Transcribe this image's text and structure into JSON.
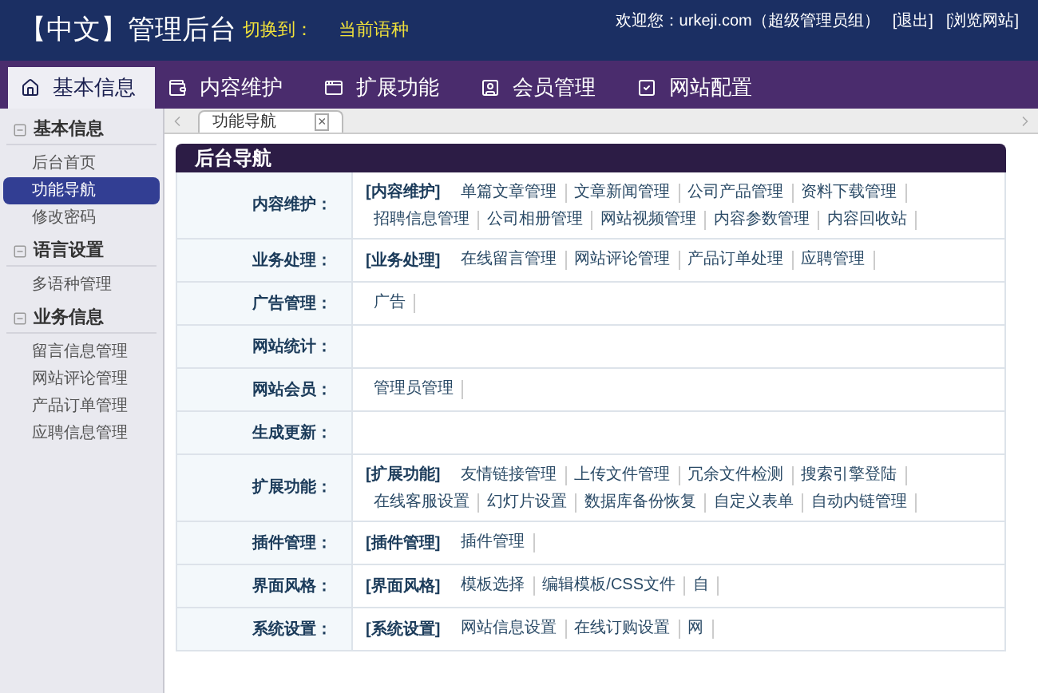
{
  "header": {
    "title": "【中文】管理后台",
    "switch_label": "切换到：",
    "current_language": "当前语种",
    "links": [
      "欢迎您：urkeji.com（超级管理员组）",
      "[退出]",
      "[浏览网站]"
    ]
  },
  "main_tabs": [
    {
      "label": "基本信息",
      "selected": true
    },
    {
      "label": "内容维护",
      "selected": false
    },
    {
      "label": "扩展功能",
      "selected": false
    },
    {
      "label": "会员管理",
      "selected": false
    },
    {
      "label": "网站配置",
      "selected": false
    }
  ],
  "sidebar": {
    "groups": [
      {
        "title": "基本信息",
        "items": [
          {
            "label": "后台首页",
            "selected": false
          },
          {
            "label": "功能导航",
            "selected": true
          },
          {
            "label": "修改密码",
            "selected": false
          }
        ]
      },
      {
        "title": "语言设置",
        "items": [
          {
            "label": "多语种管理",
            "selected": false
          }
        ]
      },
      {
        "title": "业务信息",
        "items": [
          {
            "label": "留言信息管理",
            "selected": false
          },
          {
            "label": "网站评论管理",
            "selected": false
          },
          {
            "label": "产品订单管理",
            "selected": false
          },
          {
            "label": "应聘信息管理",
            "selected": false
          }
        ]
      }
    ]
  },
  "page_tabs": [
    {
      "label": "功能导航",
      "close": "×",
      "selected": true
    }
  ],
  "panel": {
    "title": "后台导航",
    "rows": [
      {
        "label": "内容维护：",
        "links": [
          {
            "kind": "section",
            "text": "[内容维护]"
          },
          {
            "kind": "link",
            "text": "单篇文章管理"
          },
          {
            "kind": "link",
            "text": "文章新闻管理"
          },
          {
            "kind": "link",
            "text": "公司产品管理"
          },
          {
            "kind": "link",
            "text": "资料下载管理"
          },
          {
            "kind": "link",
            "text": "招聘信息管理"
          },
          {
            "kind": "link",
            "text": "公司相册管理"
          },
          {
            "kind": "link",
            "text": "网站视频管理"
          },
          {
            "kind": "link",
            "text": "内容参数管理"
          },
          {
            "kind": "link",
            "text": "内容回收站"
          }
        ]
      },
      {
        "label": "业务处理：",
        "links": [
          {
            "kind": "section",
            "text": "[业务处理]"
          },
          {
            "kind": "link",
            "text": "在线留言管理"
          },
          {
            "kind": "link",
            "text": "网站评论管理"
          },
          {
            "kind": "link",
            "text": "产品订单处理"
          },
          {
            "kind": "link",
            "text": "应聘管理"
          }
        ]
      },
      {
        "label": "广告管理：",
        "links": [
          {
            "kind": "link",
            "text": "广告"
          }
        ]
      },
      {
        "label": "网站统计：",
        "links": []
      },
      {
        "label": "网站会员：",
        "links": [
          {
            "kind": "link",
            "text": "管理员管理"
          }
        ]
      },
      {
        "label": "生成更新：",
        "links": []
      },
      {
        "label": "扩展功能：",
        "links": [
          {
            "kind": "section",
            "text": "[扩展功能]"
          },
          {
            "kind": "link",
            "text": "友情链接管理"
          },
          {
            "kind": "link",
            "text": "上传文件管理"
          },
          {
            "kind": "link",
            "text": "冗余文件检测"
          },
          {
            "kind": "link",
            "text": "搜索引擎登陆"
          },
          {
            "kind": "link",
            "text": "在线客服设置"
          },
          {
            "kind": "link",
            "text": "幻灯片设置"
          },
          {
            "kind": "link",
            "text": "数据库备份恢复"
          },
          {
            "kind": "link",
            "text": "自定义表单"
          },
          {
            "kind": "link",
            "text": "自动内链管理"
          }
        ]
      },
      {
        "label": "插件管理：",
        "links": [
          {
            "kind": "section",
            "text": "[插件管理]"
          },
          {
            "kind": "link",
            "text": "插件管理"
          }
        ]
      },
      {
        "label": "界面风格：",
        "links": [
          {
            "kind": "section",
            "text": "[界面风格]"
          },
          {
            "kind": "link",
            "text": "模板选择"
          },
          {
            "kind": "link",
            "text": "编辑模板/CSS文件"
          },
          {
            "kind": "link",
            "text": "自"
          }
        ]
      },
      {
        "label": "系统设置：",
        "links": [
          {
            "kind": "section",
            "text": "[系统设置]"
          },
          {
            "kind": "link",
            "text": "网站信息设置"
          },
          {
            "kind": "link",
            "text": "在线订购设置"
          },
          {
            "kind": "link",
            "text": "网"
          }
        ]
      }
    ]
  }
}
